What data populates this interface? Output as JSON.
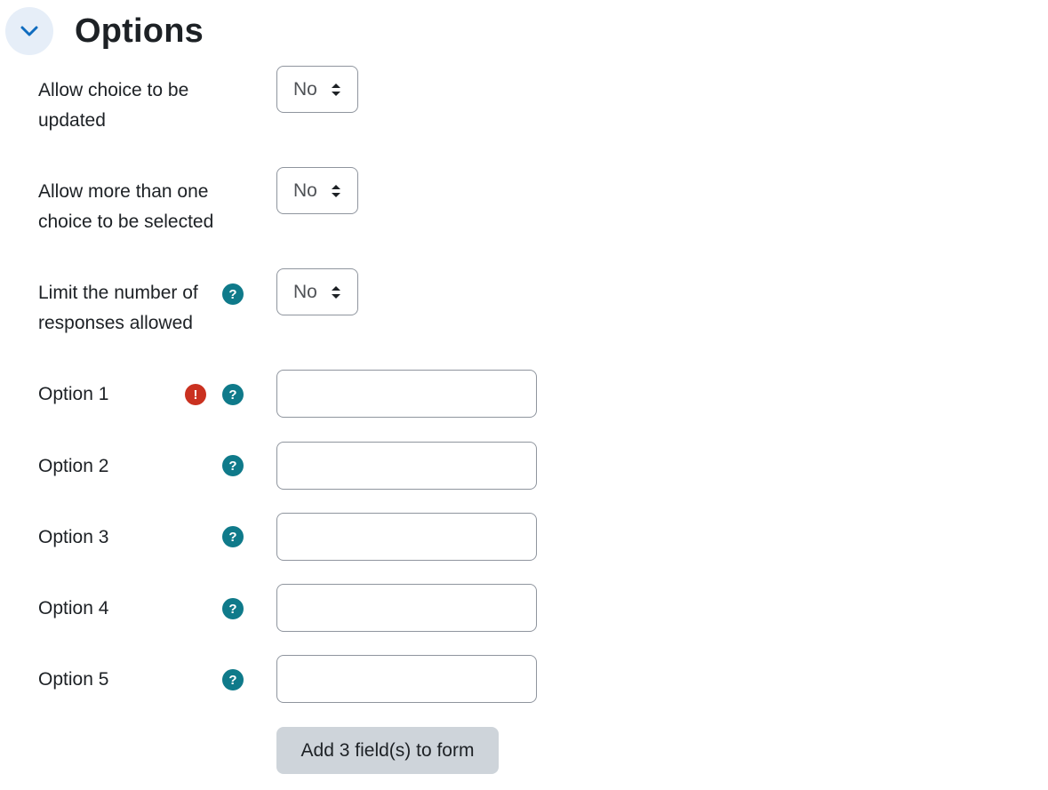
{
  "section": {
    "title": "Options",
    "toggle_icon": "chevron-down-icon",
    "accent_color": "#0f6cbf"
  },
  "settings": [
    {
      "label": "Allow choice to be updated",
      "value": "No",
      "has_help": false
    },
    {
      "label": "Allow more than one choice to be selected",
      "value": "No",
      "has_help": false
    },
    {
      "label": "Limit the number of responses allowed",
      "value": "No",
      "has_help": true
    }
  ],
  "options": [
    {
      "label": "Option 1",
      "value": "",
      "has_error": true,
      "has_help": true
    },
    {
      "label": "Option 2",
      "value": "",
      "has_error": false,
      "has_help": true
    },
    {
      "label": "Option 3",
      "value": "",
      "has_error": false,
      "has_help": true
    },
    {
      "label": "Option 4",
      "value": "",
      "has_error": false,
      "has_help": true
    },
    {
      "label": "Option 5",
      "value": "",
      "has_error": false,
      "has_help": true
    }
  ],
  "icons": {
    "help": "?",
    "error": "!",
    "help_color": "#0f7a8a",
    "error_color": "#ca3120"
  },
  "add_fields_button": "Add 3 field(s) to form"
}
